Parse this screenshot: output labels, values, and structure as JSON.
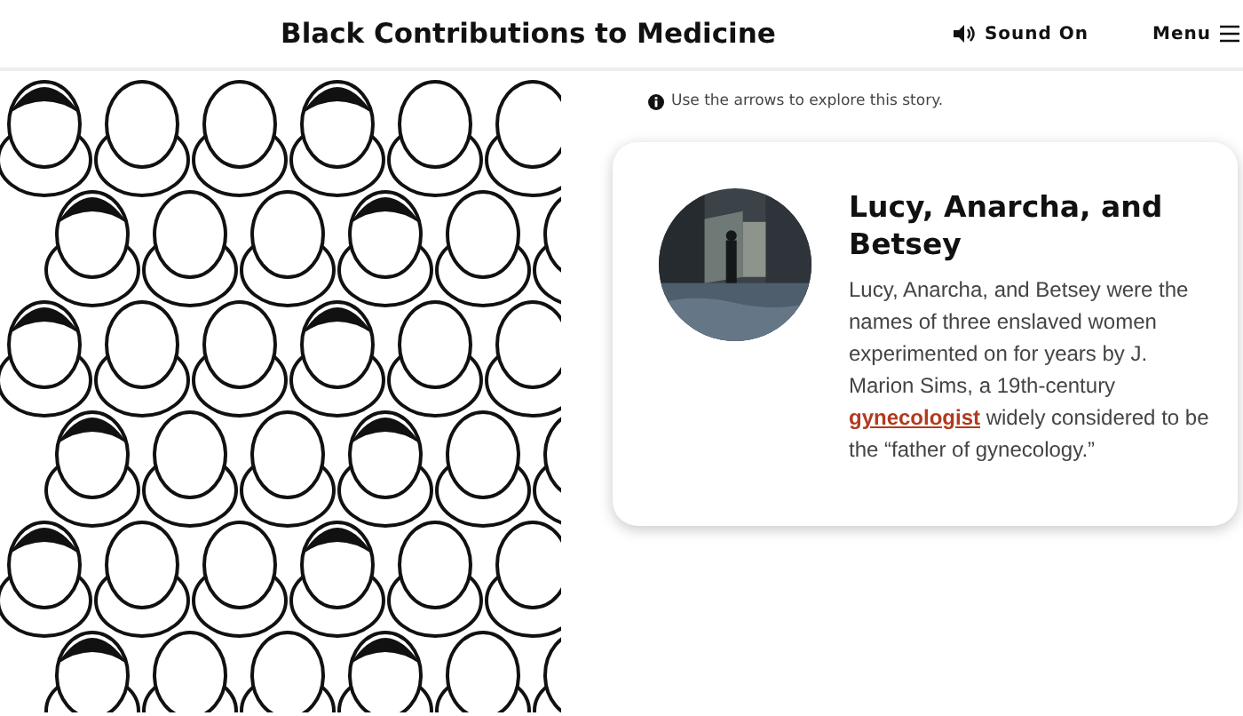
{
  "header": {
    "title": "Black Contributions to Medicine",
    "sound": "Sound On",
    "menu": "Menu"
  },
  "hint": "Use the arrows to explore this story.",
  "card": {
    "title": "Lucy, Anarcha, and Betsey",
    "body": {
      "before": "Lucy, Anarcha, and Betsey were the names of three enslaved women experimented on for years by J. Marion Sims, a 19th-century",
      "link": "gynecologist",
      "after": "widely considered to be the “father of gynecology.”"
    }
  }
}
